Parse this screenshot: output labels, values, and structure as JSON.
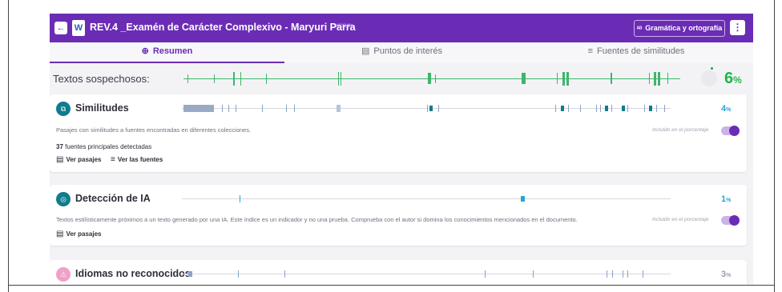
{
  "topbar": {
    "back_icon": "arrow-left-icon",
    "doc_icon": "W",
    "title": "REV.4 _Examén de Carácter Complexivo - Maryuri Parra",
    "doc_id": "#9324fe",
    "grammar_icon": "ᴬᴮ",
    "grammar_button": "Gramática y ortografía",
    "menu_icon": "⋮"
  },
  "tabs": [
    {
      "label": "Resumen",
      "icon": "⊕",
      "active": true
    },
    {
      "label": "Puntos de interés",
      "icon": "▤",
      "active": false
    },
    {
      "label": "Fuentes de similitudes",
      "icon": "≡",
      "active": false
    }
  ],
  "suspicious": {
    "label": "Textos sospechosos:",
    "percent": "6",
    "percent_unit": "%",
    "color": "#22b54a"
  },
  "similarities": {
    "title": "Similitudes",
    "percent": "4",
    "percent_unit": "%",
    "description": "Pasajes con similitudes a fuentes encontradas en diferentes colecciones.",
    "included_label": "Incluido en el porcentaje",
    "toggle_on": true,
    "sources_count": "37",
    "sources_text": "fuentes principales detectadas",
    "view_passages": "Ver pasajes",
    "view_sources": "Ver las fuentes"
  },
  "ai_detection": {
    "title": "Detección de IA",
    "percent": "1",
    "percent_unit": "%",
    "description": "Textos estilísticamente próximos a un texto generado por una IA. Este índice es un indicador y no una prueba. Comprueba con el autor si domina los conocimientos mencionados en el documento.",
    "included_label": "Incluido en el porcentaje",
    "toggle_on": true,
    "view_passages": "Ver pasajes"
  },
  "unrecognized_languages": {
    "title": "Idiomas no reconocidos",
    "percent": "3",
    "percent_unit": "%"
  },
  "colors": {
    "brand_purple": "#6b2cb5",
    "teal": "#0f7c8e",
    "percent_blue": "#29a3d6",
    "suspicious_green": "#22b54a"
  }
}
